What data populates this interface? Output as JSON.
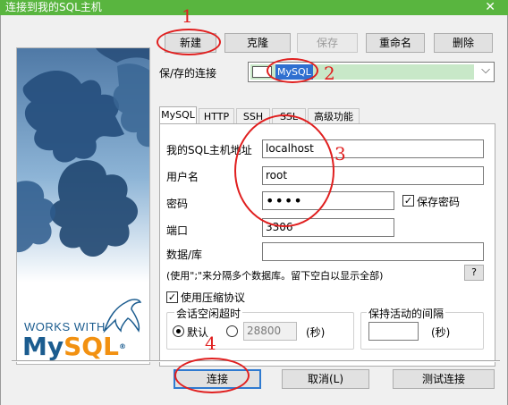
{
  "window": {
    "title": "连接到我的SQL主机",
    "close_glyph": "✕"
  },
  "toolbar": {
    "new_label": "新建",
    "clone_label": "克隆",
    "save_label": "保存",
    "rename_label": "重命名",
    "delete_label": "删除"
  },
  "saved_connection": {
    "label": "保/存的连接",
    "value": "MySQL",
    "arrow": "⌵"
  },
  "tabs": [
    {
      "label": "MySQL"
    },
    {
      "label": "HTTP"
    },
    {
      "label": "SSH"
    },
    {
      "label": "SSL"
    },
    {
      "label": "高级功能"
    }
  ],
  "form": {
    "host_label": "我的SQL主机地址",
    "host_value": "localhost",
    "user_label": "用户名",
    "user_value": "root",
    "password_label": "密码",
    "password_value": "••••",
    "save_password_label": "保存密码",
    "save_password_checked": true,
    "port_label": "端口",
    "port_value": "3306",
    "database_label": "数据/库",
    "database_value": "",
    "hint": "(使用\";\"来分隔多个数据库。留下空白以显示全部)",
    "help_label": "?",
    "compress_label": "使用压缩协议",
    "compress_checked": true,
    "check_mark": "☑"
  },
  "idle_timeout": {
    "title": "会话空闲超时",
    "default_label": "默认",
    "custom_value": "28800",
    "unit": "(秒)"
  },
  "keepalive": {
    "title": "保持活动的间隔",
    "value": "",
    "unit": "(秒)"
  },
  "footer": {
    "connect_label": "连接",
    "cancel_label": "取消(L)",
    "test_label": "测试连接"
  },
  "branding": {
    "works_with": "WORKS WITH",
    "logo": "MySQL"
  },
  "annotations": [
    "1",
    "2",
    "3",
    "4"
  ],
  "colors": {
    "titlebar": "#59b53f",
    "combo_selection": "#c8e8c8",
    "annotation": "#e01f1f",
    "mysql_blue": "#1b5c8f",
    "mysql_orange": "#f29111",
    "puzzle_blue": "#27507e"
  }
}
